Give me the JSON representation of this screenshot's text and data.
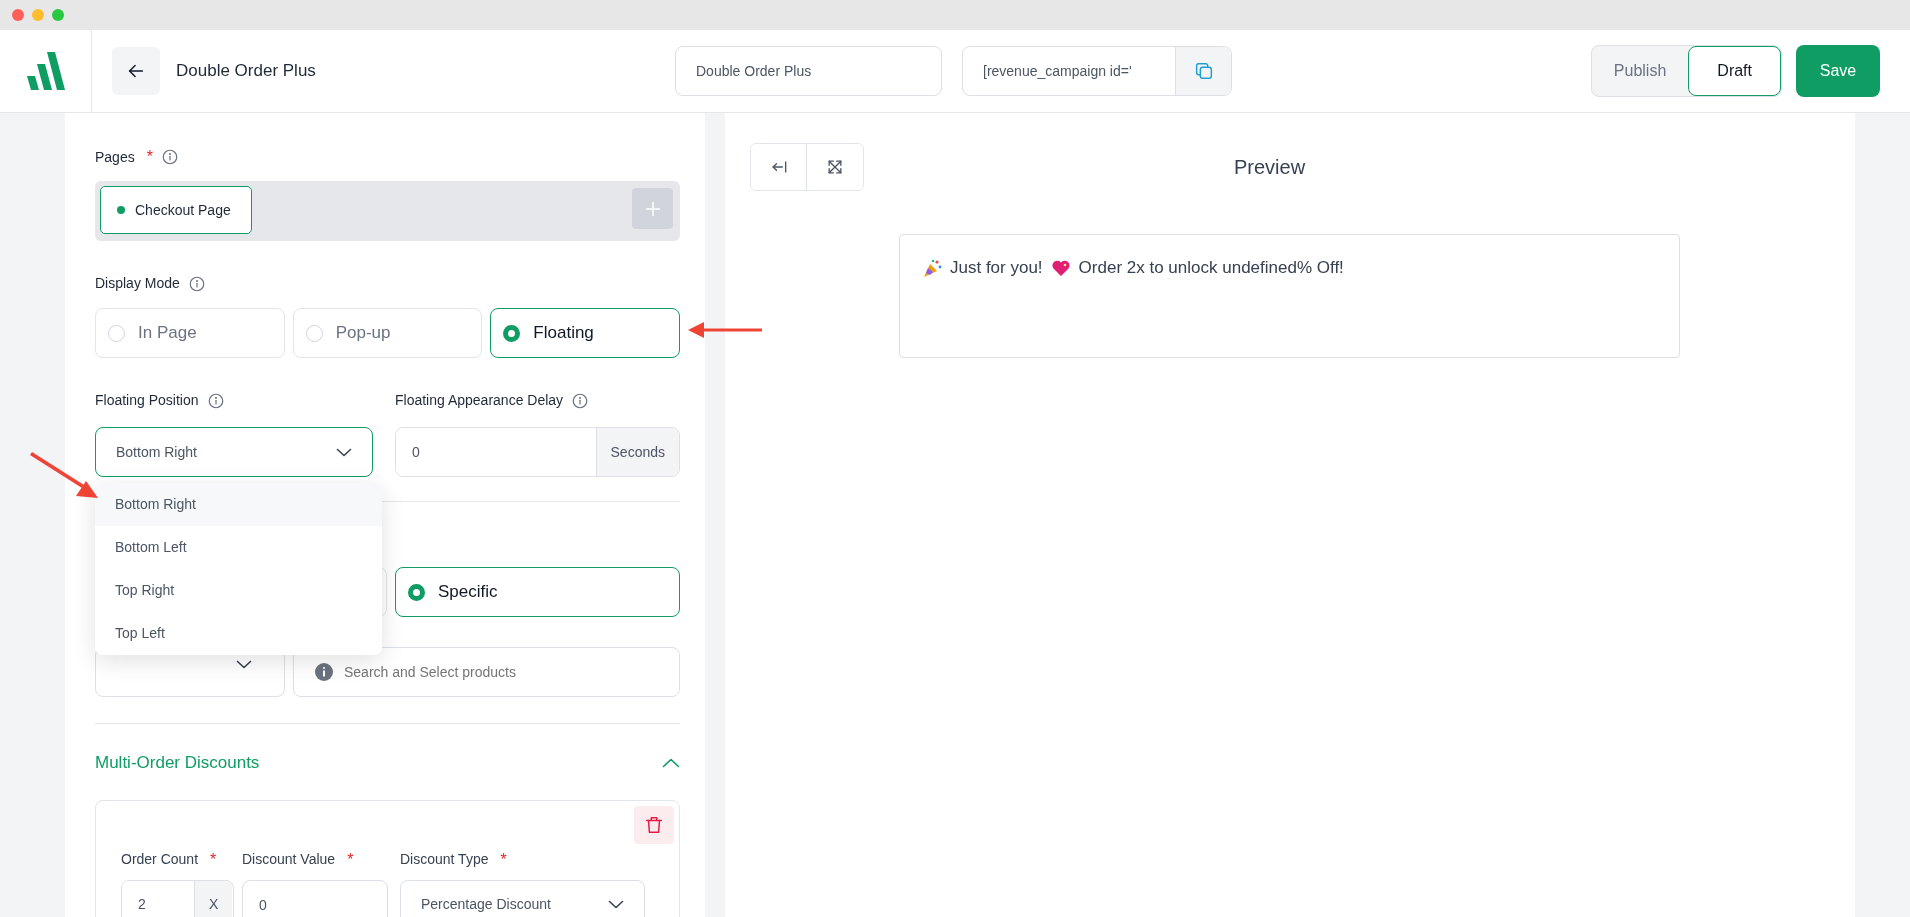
{
  "header": {
    "title": "Double Order Plus",
    "campaign_name": "Double Order Plus",
    "shortcode": "[revenue_campaign id='",
    "status": [
      {
        "label": "Publish",
        "selected": false
      },
      {
        "label": "Draft",
        "selected": true
      }
    ],
    "save": "Save"
  },
  "settings": {
    "pages": {
      "label": "Pages",
      "mark": "*",
      "chips": [
        {
          "label": "Checkout Page"
        }
      ]
    },
    "display_mode": {
      "label": "Display Mode",
      "options": [
        {
          "label": "In Page",
          "selected": false
        },
        {
          "label": "Pop-up",
          "selected": false
        },
        {
          "label": "Floating",
          "selected": true
        }
      ]
    },
    "floating_position": {
      "label": "Floating Position",
      "value": "Bottom Right",
      "expanded": true,
      "options": [
        {
          "label": "Bottom Right",
          "selected": true
        },
        {
          "label": "Bottom Left",
          "selected": false
        },
        {
          "label": "Top Right",
          "selected": false
        },
        {
          "label": "Top Left",
          "selected": false
        }
      ]
    },
    "appearance_delay": {
      "label": "Floating Appearance Delay",
      "value": "0",
      "unit": "Seconds"
    },
    "product_scope": {
      "options": [
        {
          "selected": false
        },
        {
          "label": "Specific",
          "selected": true
        }
      ],
      "search_placeholder": "Search and Select products"
    },
    "multi_order_discounts": {
      "title": "Multi-Order Discounts",
      "expanded": true,
      "tiers": [
        {
          "order_count_label": "Order Count",
          "order_count": "2",
          "order_count_unit": "X",
          "discount_value_label": "Discount Value",
          "discount_value": "0",
          "discount_type_label": "Discount Type",
          "discount_type": "Percentage Discount",
          "mark": "*"
        }
      ]
    }
  },
  "preview": {
    "title": "Preview",
    "message": [
      "Just for you!",
      "Order 2x to unlock undefined% Off!"
    ]
  },
  "annotations": [
    {
      "kind": "left"
    },
    {
      "kind": "down-right"
    }
  ]
}
